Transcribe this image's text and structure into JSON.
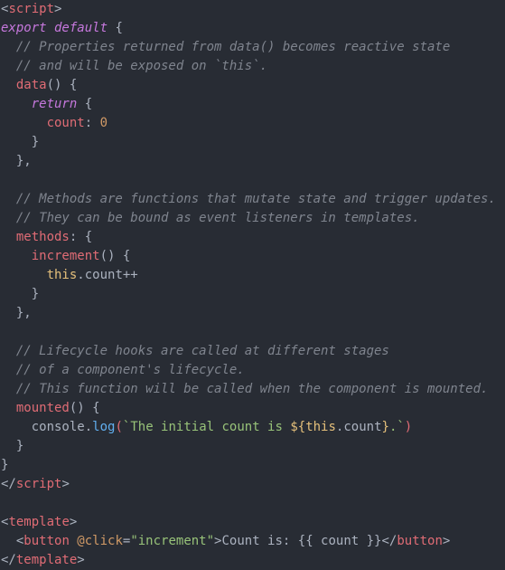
{
  "code": {
    "lines": [
      [
        {
          "t": "<",
          "c": "punct"
        },
        {
          "t": "script",
          "c": "tag"
        },
        {
          "t": ">",
          "c": "punct"
        }
      ],
      [
        {
          "t": "export default",
          "c": "keyword"
        },
        {
          "t": " {",
          "c": "punct"
        }
      ],
      [
        {
          "t": "  // Properties returned from data() becomes reactive state",
          "c": "comment"
        }
      ],
      [
        {
          "t": "  // and will be exposed on `this`.",
          "c": "comment"
        }
      ],
      [
        {
          "t": "  ",
          "c": "plain"
        },
        {
          "t": "data",
          "c": "func"
        },
        {
          "t": "() {",
          "c": "punct"
        }
      ],
      [
        {
          "t": "    ",
          "c": "plain"
        },
        {
          "t": "return",
          "c": "keyword"
        },
        {
          "t": " {",
          "c": "punct"
        }
      ],
      [
        {
          "t": "      ",
          "c": "plain"
        },
        {
          "t": "count",
          "c": "prop"
        },
        {
          "t": ": ",
          "c": "punct"
        },
        {
          "t": "0",
          "c": "number"
        }
      ],
      [
        {
          "t": "    }",
          "c": "punct"
        }
      ],
      [
        {
          "t": "  },",
          "c": "punct"
        }
      ],
      [
        {
          "t": "",
          "c": "plain"
        }
      ],
      [
        {
          "t": "  // Methods are functions that mutate state and trigger updates.",
          "c": "comment"
        }
      ],
      [
        {
          "t": "  // They can be bound as event listeners in templates.",
          "c": "comment"
        }
      ],
      [
        {
          "t": "  ",
          "c": "plain"
        },
        {
          "t": "methods",
          "c": "prop"
        },
        {
          "t": ": {",
          "c": "punct"
        }
      ],
      [
        {
          "t": "    ",
          "c": "plain"
        },
        {
          "t": "increment",
          "c": "func"
        },
        {
          "t": "() {",
          "c": "punct"
        }
      ],
      [
        {
          "t": "      ",
          "c": "plain"
        },
        {
          "t": "this",
          "c": "this"
        },
        {
          "t": ".count++",
          "c": "plain"
        }
      ],
      [
        {
          "t": "    }",
          "c": "punct"
        }
      ],
      [
        {
          "t": "  },",
          "c": "punct"
        }
      ],
      [
        {
          "t": "",
          "c": "plain"
        }
      ],
      [
        {
          "t": "  // Lifecycle hooks are called at different stages",
          "c": "comment"
        }
      ],
      [
        {
          "t": "  // of a component's lifecycle.",
          "c": "comment"
        }
      ],
      [
        {
          "t": "  // This function will be called when the component is mounted.",
          "c": "comment"
        }
      ],
      [
        {
          "t": "  ",
          "c": "plain"
        },
        {
          "t": "mounted",
          "c": "func"
        },
        {
          "t": "() {",
          "c": "punct"
        }
      ],
      [
        {
          "t": "    ",
          "c": "plain"
        },
        {
          "t": "console",
          "c": "plain"
        },
        {
          "t": ".",
          "c": "punct"
        },
        {
          "t": "log",
          "c": "method"
        },
        {
          "t": "(",
          "c": "func"
        },
        {
          "t": "`The initial count is ",
          "c": "string"
        },
        {
          "t": "${",
          "c": "this"
        },
        {
          "t": "this",
          "c": "this"
        },
        {
          "t": ".count",
          "c": "plain"
        },
        {
          "t": "}",
          "c": "this"
        },
        {
          "t": ".`",
          "c": "string"
        },
        {
          "t": ")",
          "c": "func"
        }
      ],
      [
        {
          "t": "  }",
          "c": "punct"
        }
      ],
      [
        {
          "t": "}",
          "c": "punct"
        }
      ],
      [
        {
          "t": "</",
          "c": "punct"
        },
        {
          "t": "script",
          "c": "tag"
        },
        {
          "t": ">",
          "c": "punct"
        }
      ],
      [
        {
          "t": "",
          "c": "plain"
        }
      ],
      [
        {
          "t": "<",
          "c": "punct"
        },
        {
          "t": "template",
          "c": "tag"
        },
        {
          "t": ">",
          "c": "punct"
        }
      ],
      [
        {
          "t": "  <",
          "c": "punct"
        },
        {
          "t": "button",
          "c": "tag"
        },
        {
          "t": " @click",
          "c": "attr"
        },
        {
          "t": "=",
          "c": "punct"
        },
        {
          "t": "\"increment\"",
          "c": "attrval"
        },
        {
          "t": ">Count is: {{ count }}</",
          "c": "text"
        },
        {
          "t": "button",
          "c": "tag"
        },
        {
          "t": ">",
          "c": "punct"
        }
      ],
      [
        {
          "t": "</",
          "c": "punct"
        },
        {
          "t": "template",
          "c": "tag"
        },
        {
          "t": ">",
          "c": "punct"
        }
      ]
    ]
  },
  "colors": {
    "background": "#282c34",
    "tag": "#e06c75",
    "keyword": "#c678dd",
    "comment": "#7f848e",
    "number": "#d19a66",
    "string": "#98c379"
  }
}
